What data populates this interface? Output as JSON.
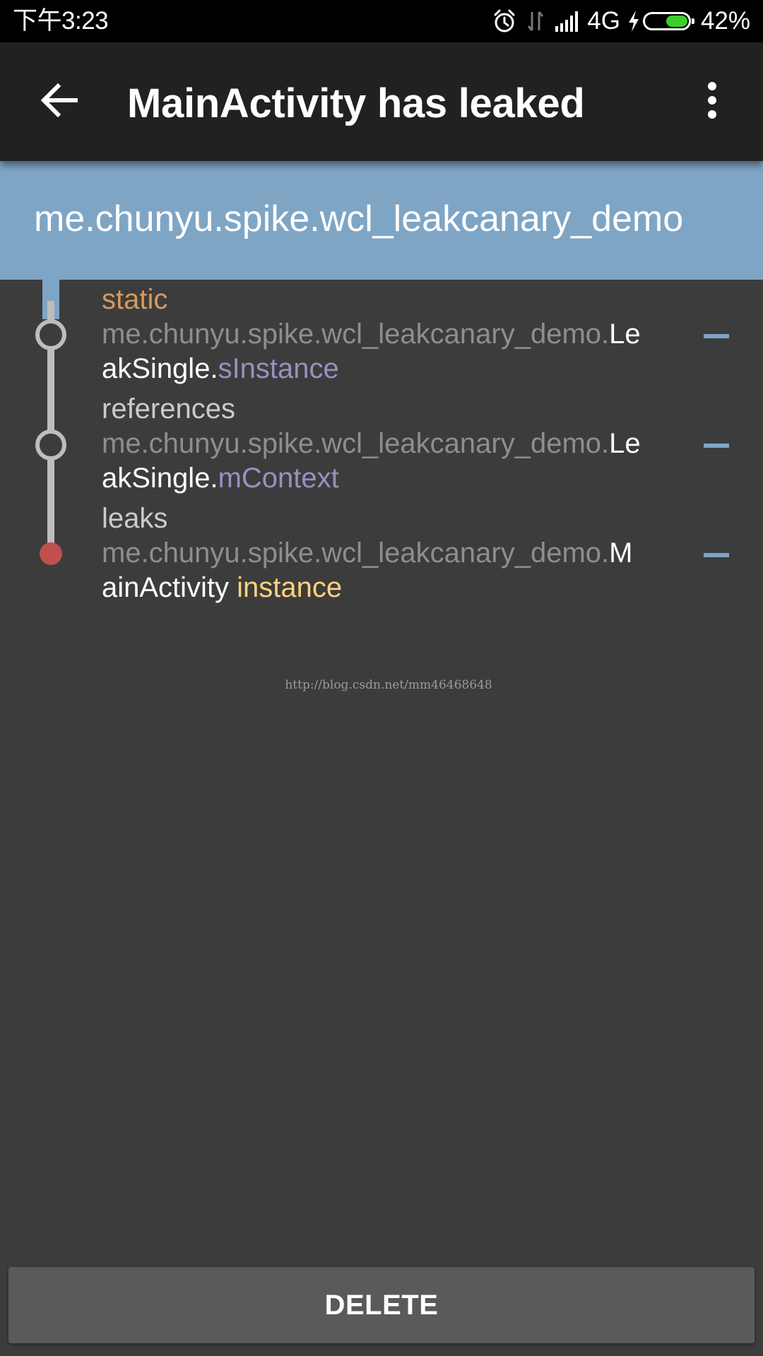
{
  "status_bar": {
    "time": "下午3:23",
    "network": "4G",
    "battery": "42%",
    "battery_level": 0.42,
    "icons": [
      "alarm-icon",
      "data-arrows-icon",
      "signal-icon",
      "charging-icon",
      "battery-icon"
    ]
  },
  "toolbar": {
    "title": "MainActivity has leaked",
    "back_icon": "arrow-left-icon",
    "menu_icon": "more-vert-icon"
  },
  "banner": {
    "package": "me.chunyu.spike.wcl_leakcanary_demo"
  },
  "trace": [
    {
      "kind": "static",
      "package": "me.chunyu.spike.wcl_leakcanary_demo.",
      "class_head": "Le",
      "class_tail": "akSingle.",
      "member": "sInstance"
    },
    {
      "kind": "references",
      "package": "me.chunyu.spike.wcl_leakcanary_demo.",
      "class_head": "Le",
      "class_tail": "akSingle.",
      "member": "mContext"
    },
    {
      "kind": "leaks",
      "package": "me.chunyu.spike.wcl_leakcanary_demo.",
      "class_head": "M",
      "class_tail": "ainActivity ",
      "member": "instance"
    }
  ],
  "watermark": "http://blog.csdn.net/mm46468648",
  "delete_button": "DELETE",
  "colors": {
    "status_bar": "#000000",
    "toolbar": "#212121",
    "banner": "#7fa5c5",
    "background": "#3c3c3c",
    "static_label": "#d69a5a",
    "field": "#9d8ec0",
    "instance": "#ffd27f",
    "leak_node": "#c0504d",
    "battery_fill": "#3ccf2a"
  }
}
